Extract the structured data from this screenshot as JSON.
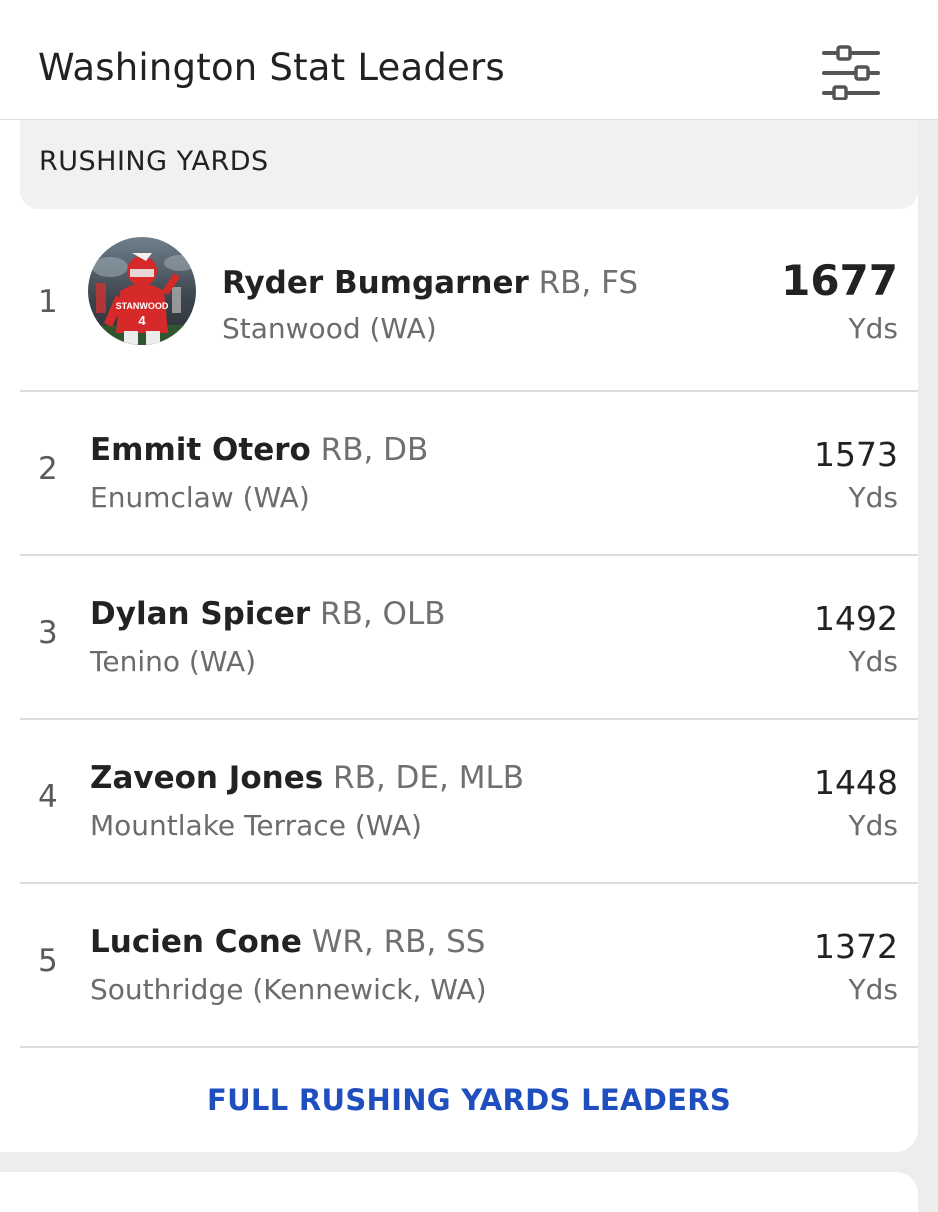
{
  "header": {
    "title": "Washington Stat Leaders",
    "filter_icon": "sliders-icon"
  },
  "section": {
    "label": "RUSHING YARDS"
  },
  "leaders": [
    {
      "rank": "1",
      "name": "Ryder Bumgarner",
      "positions": "RB, FS",
      "school": "Stanwood (WA)",
      "value": "1677",
      "unit": "Yds",
      "has_photo": true
    },
    {
      "rank": "2",
      "name": "Emmit Otero",
      "positions": "RB, DB",
      "school": "Enumclaw (WA)",
      "value": "1573",
      "unit": "Yds"
    },
    {
      "rank": "3",
      "name": "Dylan Spicer",
      "positions": "RB, OLB",
      "school": "Tenino (WA)",
      "value": "1492",
      "unit": "Yds"
    },
    {
      "rank": "4",
      "name": "Zaveon Jones",
      "positions": "RB, DE, MLB",
      "school": "Mountlake Terrace (WA)",
      "value": "1448",
      "unit": "Yds"
    },
    {
      "rank": "5",
      "name": "Lucien Cone",
      "positions": "WR, RB, SS",
      "school": "Southridge (Kennewick, WA)",
      "value": "1372",
      "unit": "Yds"
    }
  ],
  "footer": {
    "link_label": "FULL RUSHING YARDS LEADERS"
  },
  "colors": {
    "link": "#1f4fbf",
    "jersey": "#d62a2a"
  }
}
